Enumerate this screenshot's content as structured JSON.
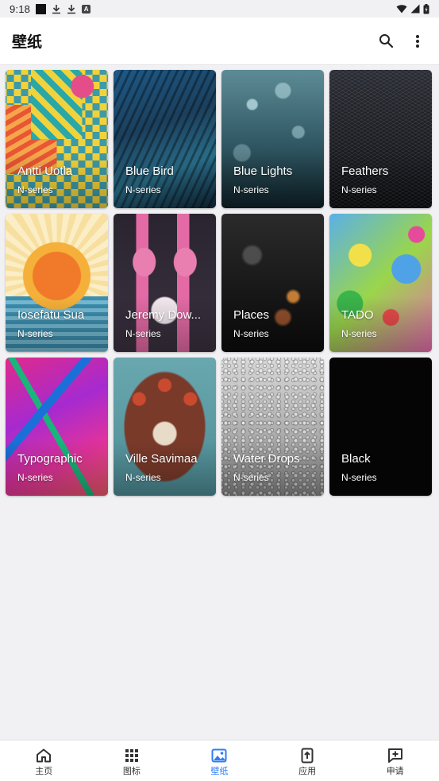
{
  "status_bar": {
    "time": "9:18",
    "notification_icons": [
      "square-icon",
      "download-icon",
      "download-icon",
      "a-icon"
    ],
    "a_icon_letter": "A",
    "system_icons": [
      "wifi-icon",
      "signal-icon",
      "battery-icon"
    ]
  },
  "app_bar": {
    "title": "壁纸",
    "actions": [
      "search-icon",
      "more-vert-icon"
    ]
  },
  "wallpapers": [
    {
      "title": "Antti Uotla",
      "subtitle": "N-series"
    },
    {
      "title": "Blue Bird",
      "subtitle": "N-series"
    },
    {
      "title": "Blue Lights",
      "subtitle": "N-series"
    },
    {
      "title": "Feathers",
      "subtitle": "N-series"
    },
    {
      "title": "Iosefatu Sua",
      "subtitle": "N-series"
    },
    {
      "title": "Jeremy Dow...",
      "subtitle": "N-series"
    },
    {
      "title": "Places",
      "subtitle": "N-series"
    },
    {
      "title": "TADO",
      "subtitle": "N-series"
    },
    {
      "title": "Typographic",
      "subtitle": "N-series"
    },
    {
      "title": "Ville Savimaa",
      "subtitle": "N-series"
    },
    {
      "title": "Water Drops",
      "subtitle": "N-series"
    },
    {
      "title": "Black",
      "subtitle": "N-series"
    }
  ],
  "bottom_nav": {
    "active_color": "#2f7df6",
    "items": [
      {
        "label": "主页",
        "icon": "home-icon"
      },
      {
        "label": "图标",
        "icon": "grid-icon"
      },
      {
        "label": "壁纸",
        "icon": "image-icon",
        "active": true
      },
      {
        "label": "应用",
        "icon": "apply-icon"
      },
      {
        "label": "申请",
        "icon": "request-icon"
      }
    ]
  }
}
